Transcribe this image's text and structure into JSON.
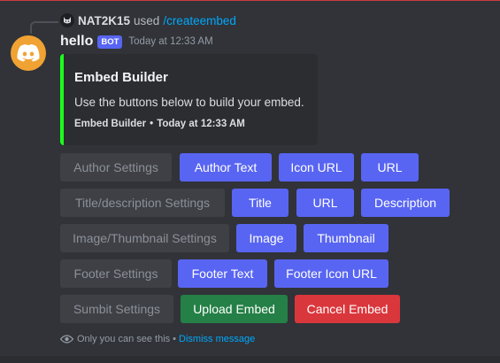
{
  "command": {
    "user": "NAT2K15",
    "used_text": "used",
    "command_name": "/createembed"
  },
  "message": {
    "username": "hello",
    "bot_tag": "BOT",
    "timestamp": "Today at 12:33 AM"
  },
  "embed": {
    "accent_color": "#1dff1d",
    "title": "Embed Builder",
    "description": "Use the buttons below to build your embed.",
    "footer_text": "Embed Builder",
    "footer_separator": "•",
    "footer_timestamp": "Today at 12:33 AM"
  },
  "button_rows": [
    {
      "section": "Author Settings",
      "buttons": [
        "Author Text",
        "Icon URL",
        "URL"
      ]
    },
    {
      "section": "Title/description Settings",
      "buttons": [
        "Title",
        "URL",
        "Description"
      ]
    },
    {
      "section": "Image/Thumbnail Settings",
      "buttons": [
        "Image",
        "Thumbnail"
      ]
    },
    {
      "section": "Footer Settings",
      "buttons": [
        "Footer Text",
        "Footer Icon URL"
      ]
    },
    {
      "section": "Sumbit Settings",
      "buttons": [
        "Upload Embed",
        "Cancel Embed"
      ]
    }
  ],
  "ephemeral": {
    "notice": "Only you can see this",
    "separator": "•",
    "dismiss": "Dismiss message"
  },
  "colors": {
    "blurple": "#5865f2",
    "success": "#248046",
    "danger": "#da373c",
    "secondary": "#3e4046",
    "link": "#00a8fc",
    "avatar": "#f0a232"
  }
}
